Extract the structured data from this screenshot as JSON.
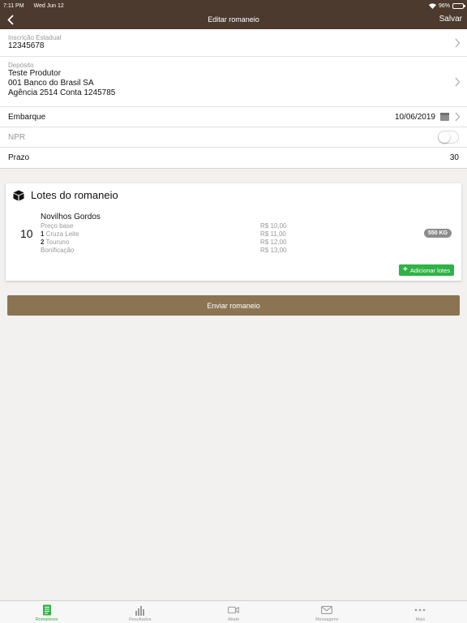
{
  "status_bar": {
    "time": "7:11 PM",
    "date": "Wed Jun 12",
    "battery": "96%"
  },
  "nav": {
    "title": "Editar romaneio",
    "save_label": "Salvar"
  },
  "form": {
    "inscricao": {
      "label": "Inscrição Estadual",
      "value": "12345678"
    },
    "deposito": {
      "label": "Depósito",
      "line1": "Teste Produtor",
      "line2": "001 Banco do Brasil SA",
      "line3": "Agência 2514  Conta 1245785"
    },
    "embarque": {
      "label": "Embarque",
      "value": "10/06/2019"
    },
    "npr": {
      "label": "NPR",
      "enabled": false
    },
    "prazo": {
      "label": "Prazo",
      "value": "30"
    }
  },
  "lotes": {
    "title": "Lotes do romaneio",
    "items": [
      {
        "quantity": "10",
        "name": "Novilhos Gordos",
        "lines": [
          {
            "qty": "",
            "text": "Preço base",
            "price": "R$ 10,00"
          },
          {
            "qty": "1",
            "text": "Cruza Leite",
            "price": "R$ 11,00"
          },
          {
            "qty": "2",
            "text": "Tourunо",
            "price": "R$ 12,00"
          },
          {
            "qty": "",
            "text": "Bonificação",
            "price": "R$ 13,00"
          }
        ],
        "weight": "550 KG"
      }
    ],
    "add_label": "Adicionar lotes"
  },
  "send_label": "Enviar romaneio",
  "tabs": [
    {
      "label": "Romaneios",
      "icon": "document-icon",
      "active": true
    },
    {
      "label": "Resultados",
      "icon": "bar-chart-icon",
      "active": false
    },
    {
      "label": "Abate",
      "icon": "video-icon",
      "active": false
    },
    {
      "label": "Mensagens",
      "icon": "envelope-icon",
      "active": false
    },
    {
      "label": "Mais",
      "icon": "more-icon",
      "active": false
    }
  ],
  "colors": {
    "header": "#4d3a2f",
    "accent": "#2fb344",
    "send_button": "#8a7452"
  }
}
